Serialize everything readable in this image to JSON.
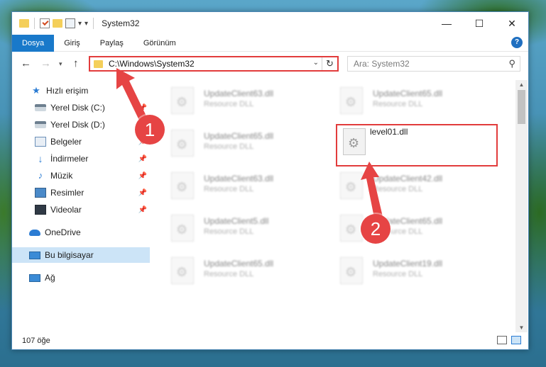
{
  "window": {
    "title": "System32",
    "minimize_glyph": "—",
    "maximize_glyph": "☐",
    "close_glyph": "✕"
  },
  "quick_access_toolbar": {
    "dropdown_glyph": "▾",
    "customize_glyph": "▾"
  },
  "ribbon": {
    "tabs": [
      {
        "label": "Dosya",
        "active": true
      },
      {
        "label": "Giriş",
        "active": false
      },
      {
        "label": "Paylaş",
        "active": false
      },
      {
        "label": "Görünüm",
        "active": false
      }
    ],
    "help_glyph": "?",
    "expand_glyph": "˅"
  },
  "address_bar": {
    "back_glyph": "←",
    "forward_glyph": "→",
    "recent_glyph": "▾",
    "up_glyph": "↑",
    "path": "C:\\Windows\\System32",
    "dropdown_glyph": "⌄",
    "refresh_glyph": "↻"
  },
  "search": {
    "placeholder": "Ara: System32",
    "icon_glyph": "⚲"
  },
  "nav_pane": {
    "items": [
      {
        "label": "Hızlı erişim",
        "icon": "star-icon",
        "pinned": false
      },
      {
        "label": "Yerel Disk (C:)",
        "icon": "drive-icon",
        "pinned": true
      },
      {
        "label": "Yerel Disk (D:)",
        "icon": "drive-icon",
        "pinned": true
      },
      {
        "label": "Belgeler",
        "icon": "documents-icon",
        "pinned": true
      },
      {
        "label": "İndirmeler",
        "icon": "downloads-icon",
        "pinned": true
      },
      {
        "label": "Müzik",
        "icon": "music-icon",
        "pinned": true
      },
      {
        "label": "Resimler",
        "icon": "pictures-icon",
        "pinned": true
      },
      {
        "label": "Videolar",
        "icon": "videos-icon",
        "pinned": true
      },
      {
        "label": "OneDrive",
        "icon": "cloud-icon",
        "pinned": false
      },
      {
        "label": "Bu bilgisayar",
        "icon": "computer-icon",
        "pinned": false,
        "selected": true
      },
      {
        "label": "Ağ",
        "icon": "network-icon",
        "pinned": false
      }
    ],
    "pin_glyph": "📌"
  },
  "files": {
    "type_label": "Resource DLL",
    "left_column": [
      "UpdateClient63.dll",
      "UpdateClient65.dll",
      "UpdateClient63.dll",
      "UpdateClient5.dll",
      "UpdateClient65.dll"
    ],
    "right_column": [
      "UpdateClient65.dll",
      "level01.dll",
      "UpdateClient42.dll",
      "UpdateClient65.dll",
      "UpdateClient19.dll"
    ],
    "highlighted_file": "level01.dll"
  },
  "status_bar": {
    "item_count": "107 öğe"
  },
  "callouts": [
    {
      "number": "1"
    },
    {
      "number": "2"
    }
  ],
  "colors": {
    "accent": "#1979ca",
    "highlight_red": "#e23c3c",
    "callout_red": "#e64444",
    "selected_bg": "#cce4f7"
  }
}
